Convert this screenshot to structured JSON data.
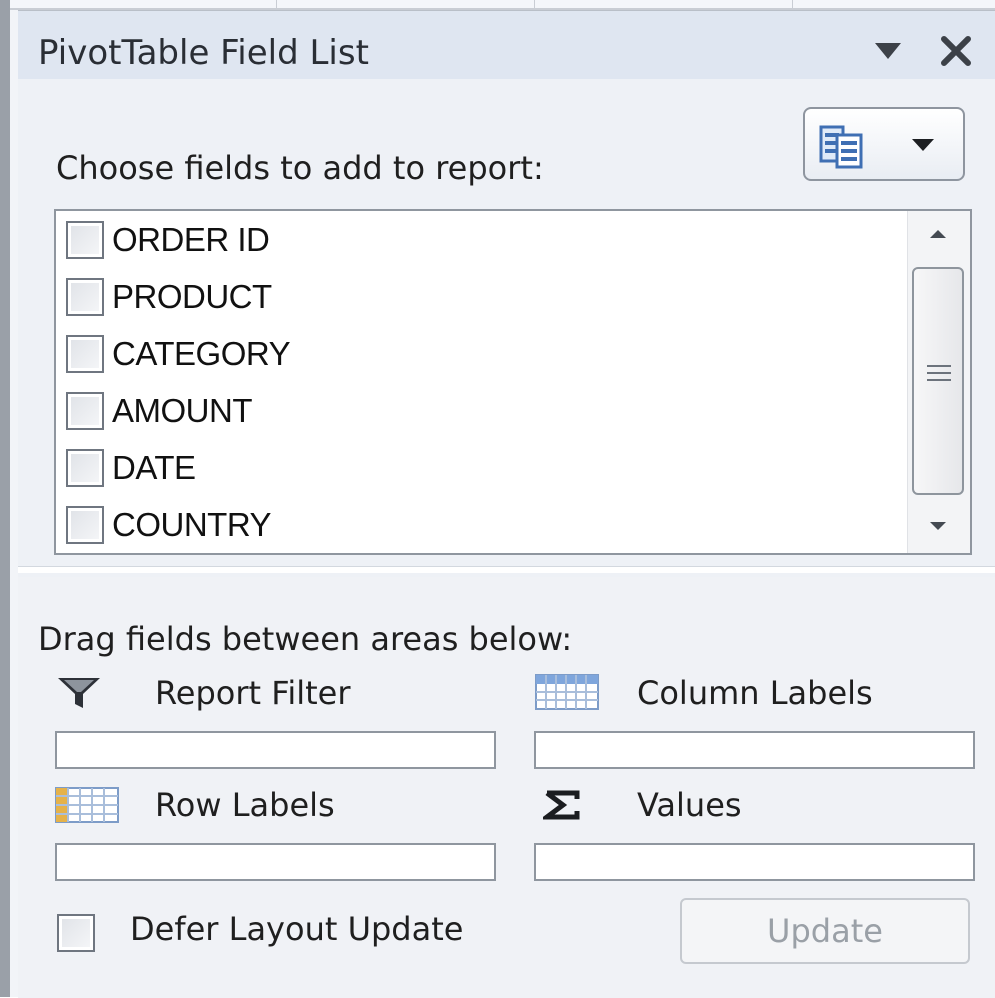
{
  "panel": {
    "title": "PivotTable Field List",
    "dropdown_icon": "triangle-down",
    "close_icon": "x"
  },
  "fields_section": {
    "choose_label": "Choose fields to add to report:",
    "layout_button_icon": "field-list-layout"
  },
  "fields": [
    {
      "label": "ORDER ID",
      "checked": false
    },
    {
      "label": "PRODUCT",
      "checked": false
    },
    {
      "label": "CATEGORY",
      "checked": false
    },
    {
      "label": "AMOUNT",
      "checked": false
    },
    {
      "label": "DATE",
      "checked": false
    },
    {
      "label": "COUNTRY",
      "checked": false
    }
  ],
  "areas": {
    "drag_label": "Drag fields between areas below:",
    "report_filter": "Report Filter",
    "column_labels": "Column Labels",
    "row_labels": "Row Labels",
    "values": "Values"
  },
  "footer": {
    "defer_label": "Defer Layout Update",
    "defer_checked": false,
    "update_label": "Update"
  },
  "colors": {
    "title_bar": "#dfe6f1",
    "panel_bg": "#eef1f6",
    "disabled_text": "#9aa0a7"
  }
}
